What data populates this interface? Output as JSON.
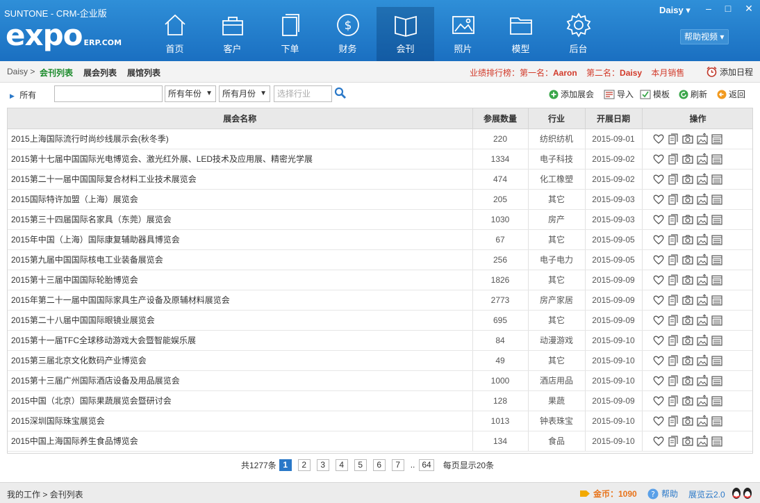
{
  "app": {
    "title": "SUNTONE - CRM-企业版",
    "logo_text": "expo",
    "logo_suffix": "ERP.COM",
    "user": "Daisy ▾",
    "help_video": "帮助视频 ▾"
  },
  "nav": [
    {
      "label": "首页",
      "icon": "home-icon"
    },
    {
      "label": "客户",
      "icon": "bag-icon"
    },
    {
      "label": "下单",
      "icon": "document-icon"
    },
    {
      "label": "财务",
      "icon": "dollar-icon"
    },
    {
      "label": "会刊",
      "icon": "book-icon",
      "active": true
    },
    {
      "label": "照片",
      "icon": "photo-icon"
    },
    {
      "label": "模型",
      "icon": "folder-icon"
    },
    {
      "label": "后台",
      "icon": "gear-icon"
    }
  ],
  "subnav": {
    "user": "Daisy >",
    "tabs": [
      "会刊列表",
      "展会列表",
      "展馆列表"
    ],
    "ranking_prefix": "业绩排行榜：第一名：",
    "rank1": "Aaron",
    "ranking_mid": "第二名：",
    "rank2": "Daisy",
    "ranking_tail": "本月销售",
    "add_schedule": "添加日程"
  },
  "toolbar": {
    "all": "所有",
    "year": "所有年份",
    "month": "所有月份",
    "industry_placeholder": "选择行业",
    "add_expo": "添加展会",
    "import": "导入",
    "template": "模板",
    "refresh": "刷新",
    "back": "返回"
  },
  "table": {
    "headers": [
      "展会名称",
      "参展数量",
      "行业",
      "开展日期",
      "操作"
    ],
    "rows": [
      [
        "2015上海国际流行时尚纱线展示会(秋冬季)",
        "220",
        "纺织纺机",
        "2015-09-01"
      ],
      [
        "2015第十七届中国国际光电博览会、激光红外展、LED技术及应用展、精密光学展",
        "1334",
        "电子科技",
        "2015-09-02"
      ],
      [
        "2015第二十一届中国国际复合材料工业技术展览会",
        "474",
        "化工橡塑",
        "2015-09-02"
      ],
      [
        "2015国际特许加盟（上海）展览会",
        "205",
        "其它",
        "2015-09-03"
      ],
      [
        "2015第三十四届国际名家具（东莞）展览会",
        "1030",
        "房产",
        "2015-09-03"
      ],
      [
        "2015年中国（上海）国际康复辅助器具博览会",
        "67",
        "其它",
        "2015-09-05"
      ],
      [
        "2015第九届中国国际核电工业装备展览会",
        "256",
        "电子电力",
        "2015-09-05"
      ],
      [
        "2015第十三届中国国际轮胎博览会",
        "1826",
        "其它",
        "2015-09-09"
      ],
      [
        "2015年第二十一届中国国际家具生产设备及原辅材料展览会",
        "2773",
        "房产家居",
        "2015-09-09"
      ],
      [
        "2015第二十八届中国国际眼镜业展览会",
        "695",
        "其它",
        "2015-09-09"
      ],
      [
        "2015第十一届TFC全球移动游戏大会暨智能娱乐展",
        "84",
        "动漫游戏",
        "2015-09-10"
      ],
      [
        "2015第三届北京文化数码产业博览会",
        "49",
        "其它",
        "2015-09-10"
      ],
      [
        "2015第十三届广州国际酒店设备及用品展览会",
        "1000",
        "酒店用品",
        "2015-09-10"
      ],
      [
        "2015中国（北京）国际果蔬展览会暨研讨会",
        "128",
        "果蔬",
        "2015-09-09"
      ],
      [
        "2015深圳国际珠宝展览会",
        "1013",
        "钟表珠宝",
        "2015-09-10"
      ],
      [
        "2015中国上海国际养生食品博览会",
        "134",
        "食品",
        "2015-09-10"
      ]
    ]
  },
  "pager": {
    "total": "共1277条",
    "pages": [
      "1",
      "2",
      "3",
      "4",
      "5",
      "6",
      "7"
    ],
    "dots": "..",
    "last": "64",
    "per_page": "每页显示20条"
  },
  "status": {
    "breadcrumb": "我的工作 > 会刊列表",
    "coins": "金币：1090",
    "help": "帮助",
    "version": "展览云2.0"
  },
  "colors": {
    "header_blue": "#1a6fc1",
    "active_tab_green": "#1a8a2a",
    "ranking_red": "#d23a2a",
    "coin_orange": "#e8731a"
  }
}
